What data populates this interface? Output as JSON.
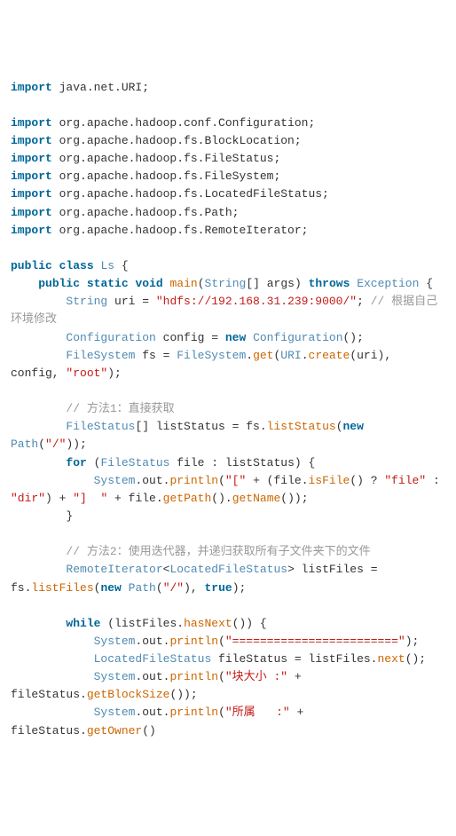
{
  "lines": [
    {
      "segments": [
        {
          "t": "import",
          "c": "kw"
        },
        {
          "t": " java.net.URI;",
          "c": "pkg"
        }
      ]
    },
    {
      "segments": []
    },
    {
      "segments": [
        {
          "t": "import",
          "c": "kw"
        },
        {
          "t": " org.apache.hadoop.conf.Configuration;",
          "c": "pkg"
        }
      ]
    },
    {
      "segments": [
        {
          "t": "import",
          "c": "kw"
        },
        {
          "t": " org.apache.hadoop.fs.BlockLocation;",
          "c": "pkg"
        }
      ]
    },
    {
      "segments": [
        {
          "t": "import",
          "c": "kw"
        },
        {
          "t": " org.apache.hadoop.fs.FileStatus;",
          "c": "pkg"
        }
      ]
    },
    {
      "segments": [
        {
          "t": "import",
          "c": "kw"
        },
        {
          "t": " org.apache.hadoop.fs.FileSystem;",
          "c": "pkg"
        }
      ]
    },
    {
      "segments": [
        {
          "t": "import",
          "c": "kw"
        },
        {
          "t": " org.apache.hadoop.fs.LocatedFileStatus;",
          "c": "pkg"
        }
      ]
    },
    {
      "segments": [
        {
          "t": "import",
          "c": "kw"
        },
        {
          "t": " org.apache.hadoop.fs.Path;",
          "c": "pkg"
        }
      ]
    },
    {
      "segments": [
        {
          "t": "import",
          "c": "kw"
        },
        {
          "t": " org.apache.hadoop.fs.RemoteIterator;",
          "c": "pkg"
        }
      ]
    },
    {
      "segments": []
    },
    {
      "segments": [
        {
          "t": "public",
          "c": "kw"
        },
        {
          "t": " ",
          "c": "op"
        },
        {
          "t": "class",
          "c": "kw"
        },
        {
          "t": " ",
          "c": "op"
        },
        {
          "t": "Ls",
          "c": "cls"
        },
        {
          "t": " {",
          "c": "op"
        }
      ]
    },
    {
      "segments": [
        {
          "t": "    ",
          "c": "op"
        },
        {
          "t": "public",
          "c": "kw"
        },
        {
          "t": " ",
          "c": "op"
        },
        {
          "t": "static",
          "c": "kw"
        },
        {
          "t": " ",
          "c": "op"
        },
        {
          "t": "void",
          "c": "kw"
        },
        {
          "t": " ",
          "c": "op"
        },
        {
          "t": "main",
          "c": "fn"
        },
        {
          "t": "(",
          "c": "op"
        },
        {
          "t": "String",
          "c": "cls"
        },
        {
          "t": "[] args) ",
          "c": "op"
        },
        {
          "t": "throws",
          "c": "kw"
        },
        {
          "t": " ",
          "c": "op"
        },
        {
          "t": "Exception",
          "c": "cls"
        },
        {
          "t": " {",
          "c": "op"
        }
      ]
    },
    {
      "segments": [
        {
          "t": "        ",
          "c": "op"
        },
        {
          "t": "String",
          "c": "cls"
        },
        {
          "t": " uri = ",
          "c": "op"
        },
        {
          "t": "\"hdfs://192.168.31.239:9000/\"",
          "c": "str"
        },
        {
          "t": "; ",
          "c": "op"
        },
        {
          "t": "// 根据自己环境修改",
          "c": "cmt"
        }
      ]
    },
    {
      "segments": [
        {
          "t": "        ",
          "c": "op"
        },
        {
          "t": "Configuration",
          "c": "cls"
        },
        {
          "t": " config = ",
          "c": "op"
        },
        {
          "t": "new",
          "c": "kw"
        },
        {
          "t": " ",
          "c": "op"
        },
        {
          "t": "Configuration",
          "c": "cls"
        },
        {
          "t": "();",
          "c": "op"
        }
      ]
    },
    {
      "segments": [
        {
          "t": "        ",
          "c": "op"
        },
        {
          "t": "FileSystem",
          "c": "cls"
        },
        {
          "t": " fs = ",
          "c": "op"
        },
        {
          "t": "FileSystem",
          "c": "cls"
        },
        {
          "t": ".",
          "c": "op"
        },
        {
          "t": "get",
          "c": "fn"
        },
        {
          "t": "(",
          "c": "op"
        },
        {
          "t": "URI",
          "c": "cls"
        },
        {
          "t": ".",
          "c": "op"
        },
        {
          "t": "create",
          "c": "fn"
        },
        {
          "t": "(uri), config, ",
          "c": "op"
        },
        {
          "t": "\"root\"",
          "c": "str"
        },
        {
          "t": ");",
          "c": "op"
        }
      ]
    },
    {
      "segments": []
    },
    {
      "segments": [
        {
          "t": "        ",
          "c": "op"
        },
        {
          "t": "// 方法1：直接获取",
          "c": "cmt"
        }
      ]
    },
    {
      "segments": [
        {
          "t": "        ",
          "c": "op"
        },
        {
          "t": "FileStatus",
          "c": "cls"
        },
        {
          "t": "[] listStatus = fs.",
          "c": "op"
        },
        {
          "t": "listStatus",
          "c": "fn"
        },
        {
          "t": "(",
          "c": "op"
        },
        {
          "t": "new",
          "c": "kw"
        },
        {
          "t": " ",
          "c": "op"
        },
        {
          "t": "Path",
          "c": "cls"
        },
        {
          "t": "(",
          "c": "op"
        },
        {
          "t": "\"/\"",
          "c": "str"
        },
        {
          "t": "));",
          "c": "op"
        }
      ]
    },
    {
      "segments": [
        {
          "t": "        ",
          "c": "op"
        },
        {
          "t": "for",
          "c": "kw"
        },
        {
          "t": " (",
          "c": "op"
        },
        {
          "t": "FileStatus",
          "c": "cls"
        },
        {
          "t": " file : listStatus) {",
          "c": "op"
        }
      ]
    },
    {
      "segments": [
        {
          "t": "            ",
          "c": "op"
        },
        {
          "t": "System",
          "c": "cls"
        },
        {
          "t": ".out.",
          "c": "op"
        },
        {
          "t": "println",
          "c": "fn"
        },
        {
          "t": "(",
          "c": "op"
        },
        {
          "t": "\"[\"",
          "c": "str"
        },
        {
          "t": " + (file.",
          "c": "op"
        },
        {
          "t": "isFile",
          "c": "fn"
        },
        {
          "t": "() ? ",
          "c": "op"
        },
        {
          "t": "\"file\"",
          "c": "str"
        },
        {
          "t": " : ",
          "c": "op"
        },
        {
          "t": "\"dir\"",
          "c": "str"
        },
        {
          "t": ") + ",
          "c": "op"
        },
        {
          "t": "\"]  \"",
          "c": "str"
        },
        {
          "t": " + file.",
          "c": "op"
        },
        {
          "t": "getPath",
          "c": "fn"
        },
        {
          "t": "().",
          "c": "op"
        },
        {
          "t": "getName",
          "c": "fn"
        },
        {
          "t": "());",
          "c": "op"
        }
      ]
    },
    {
      "segments": [
        {
          "t": "        }",
          "c": "op"
        }
      ]
    },
    {
      "segments": []
    },
    {
      "segments": [
        {
          "t": "        ",
          "c": "op"
        },
        {
          "t": "// 方法2：使用迭代器，并递归获取所有子文件夹下的文件",
          "c": "cmt"
        }
      ]
    },
    {
      "segments": [
        {
          "t": "        ",
          "c": "op"
        },
        {
          "t": "RemoteIterator",
          "c": "cls"
        },
        {
          "t": "<",
          "c": "op"
        },
        {
          "t": "LocatedFileStatus",
          "c": "cls"
        },
        {
          "t": "> listFiles = fs.",
          "c": "op"
        },
        {
          "t": "listFiles",
          "c": "fn"
        },
        {
          "t": "(",
          "c": "op"
        },
        {
          "t": "new",
          "c": "kw"
        },
        {
          "t": " ",
          "c": "op"
        },
        {
          "t": "Path",
          "c": "cls"
        },
        {
          "t": "(",
          "c": "op"
        },
        {
          "t": "\"/\"",
          "c": "str"
        },
        {
          "t": "), ",
          "c": "op"
        },
        {
          "t": "true",
          "c": "kw"
        },
        {
          "t": ");",
          "c": "op"
        }
      ]
    },
    {
      "segments": []
    },
    {
      "segments": [
        {
          "t": "        ",
          "c": "op"
        },
        {
          "t": "while",
          "c": "kw"
        },
        {
          "t": " (listFiles.",
          "c": "op"
        },
        {
          "t": "hasNext",
          "c": "fn"
        },
        {
          "t": "()) {",
          "c": "op"
        }
      ]
    },
    {
      "segments": [
        {
          "t": "            ",
          "c": "op"
        },
        {
          "t": "System",
          "c": "cls"
        },
        {
          "t": ".out.",
          "c": "op"
        },
        {
          "t": "println",
          "c": "fn"
        },
        {
          "t": "(",
          "c": "op"
        },
        {
          "t": "\"========================\"",
          "c": "str"
        },
        {
          "t": ");",
          "c": "op"
        }
      ]
    },
    {
      "segments": [
        {
          "t": "            ",
          "c": "op"
        },
        {
          "t": "LocatedFileStatus",
          "c": "cls"
        },
        {
          "t": " fileStatus = listFiles.",
          "c": "op"
        },
        {
          "t": "next",
          "c": "fn"
        },
        {
          "t": "();",
          "c": "op"
        }
      ]
    },
    {
      "segments": [
        {
          "t": "            ",
          "c": "op"
        },
        {
          "t": "System",
          "c": "cls"
        },
        {
          "t": ".out.",
          "c": "op"
        },
        {
          "t": "println",
          "c": "fn"
        },
        {
          "t": "(",
          "c": "op"
        },
        {
          "t": "\"块大小 :\"",
          "c": "str"
        },
        {
          "t": " + fileStatus.",
          "c": "op"
        },
        {
          "t": "getBlockSize",
          "c": "fn"
        },
        {
          "t": "());",
          "c": "op"
        }
      ]
    },
    {
      "segments": [
        {
          "t": "            ",
          "c": "op"
        },
        {
          "t": "System",
          "c": "cls"
        },
        {
          "t": ".out.",
          "c": "op"
        },
        {
          "t": "println",
          "c": "fn"
        },
        {
          "t": "(",
          "c": "op"
        },
        {
          "t": "\"所属   :\"",
          "c": "str"
        },
        {
          "t": " + fileStatus.",
          "c": "op"
        },
        {
          "t": "getOwner",
          "c": "fn"
        },
        {
          "t": "()",
          "c": "op"
        }
      ]
    }
  ]
}
